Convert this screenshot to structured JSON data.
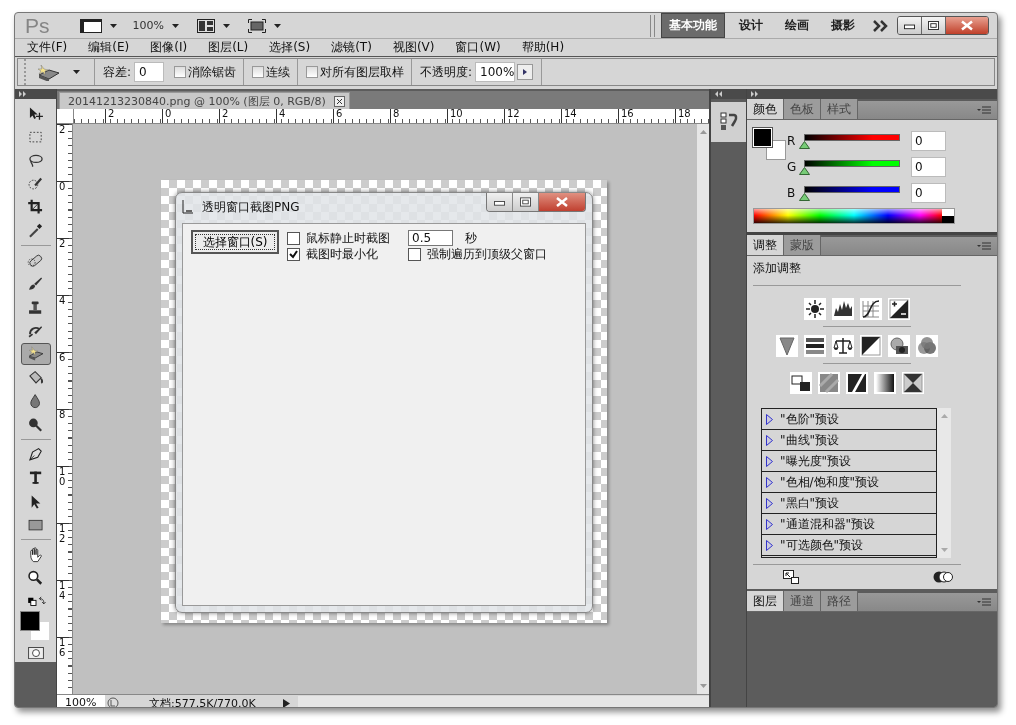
{
  "app": {
    "logo": "Ps",
    "zoom": "100%"
  },
  "workspaces": [
    {
      "label": "基本功能",
      "selected": true
    },
    {
      "label": "设计",
      "selected": false
    },
    {
      "label": "绘画",
      "selected": false
    },
    {
      "label": "摄影",
      "selected": false
    }
  ],
  "menu": [
    "文件(F)",
    "编辑(E)",
    "图像(I)",
    "图层(L)",
    "选择(S)",
    "滤镜(T)",
    "视图(V)",
    "窗口(W)",
    "帮助(H)"
  ],
  "options": {
    "tolerance_label": "容差:",
    "tolerance": "0",
    "checkboxes": [
      {
        "label": "消除锯齿",
        "checked": false
      },
      {
        "label": "连续",
        "checked": false
      },
      {
        "label": "对所有图层取样",
        "checked": false
      }
    ],
    "opacity_label": "不透明度:",
    "opacity": "100%"
  },
  "tools": [
    {
      "kind": "move",
      "selected": false
    },
    {
      "kind": "marquee",
      "selected": false
    },
    {
      "kind": "lasso",
      "selected": false
    },
    {
      "kind": "quick-select",
      "selected": false
    },
    {
      "kind": "crop",
      "selected": false
    },
    {
      "kind": "eyedropper",
      "selected": false
    },
    {
      "kind": "sep"
    },
    {
      "kind": "heal",
      "selected": false
    },
    {
      "kind": "brush",
      "selected": false
    },
    {
      "kind": "stamp",
      "selected": false
    },
    {
      "kind": "history-brush",
      "selected": false
    },
    {
      "kind": "eraser",
      "selected": true
    },
    {
      "kind": "bucket",
      "selected": false
    },
    {
      "kind": "blur",
      "selected": false
    },
    {
      "kind": "dodge",
      "selected": false
    },
    {
      "kind": "sep"
    },
    {
      "kind": "pen",
      "selected": false
    },
    {
      "kind": "type",
      "selected": false
    },
    {
      "kind": "path-select",
      "selected": false
    },
    {
      "kind": "shape",
      "selected": false
    },
    {
      "kind": "sep"
    },
    {
      "kind": "hand",
      "selected": false
    },
    {
      "kind": "zoom",
      "selected": false
    }
  ],
  "document": {
    "tab": "20141213230840.png @ 100% (图层 0, RGB/8)",
    "ruler_h": [
      "2",
      "0",
      "2",
      "4",
      "6",
      "8",
      "10",
      "12",
      "14",
      "16",
      "18"
    ],
    "ruler_v": [
      "2",
      "0",
      "2",
      "4",
      "6",
      "8",
      "10",
      "12",
      "14",
      "16"
    ],
    "status_zoom": "100%",
    "status_doc": "文档:577.5K/770.0K"
  },
  "captured_window": {
    "title": "透明窗口截图PNG",
    "button": "选择窗口(S)",
    "checkboxes": [
      {
        "label": "鼠标静止时截图",
        "checked": false
      },
      {
        "label": "截图时最小化",
        "checked": true
      }
    ],
    "interval": "0.5",
    "unit": "秒",
    "force_checkbox": {
      "label": "强制遍历到顶级父窗口",
      "checked": false
    }
  },
  "color_panel": {
    "tabs": [
      {
        "label": "颜色",
        "selected": true
      },
      {
        "label": "色板",
        "selected": false
      },
      {
        "label": "样式",
        "selected": false
      }
    ],
    "channels": [
      {
        "name": "R",
        "value": "0",
        "level": 0,
        "color": "#ff0000"
      },
      {
        "name": "G",
        "value": "0",
        "level": 0,
        "color": "#00ff00"
      },
      {
        "name": "B",
        "value": "0",
        "level": 0,
        "color": "#0000ff"
      }
    ]
  },
  "adjust_panel": {
    "tabs": [
      {
        "label": "调整",
        "selected": true
      },
      {
        "label": "蒙版",
        "selected": false
      }
    ],
    "heading": "添加调整",
    "presets": [
      "\"色阶\"预设",
      "\"曲线\"预设",
      "\"曝光度\"预设",
      "\"色相/饱和度\"预设",
      "\"黑白\"预设",
      "\"通道混和器\"预设",
      "\"可选颜色\"预设"
    ]
  },
  "layers_panel": {
    "tabs": [
      {
        "label": "图层",
        "selected": true
      },
      {
        "label": "通道",
        "selected": false
      },
      {
        "label": "路径",
        "selected": false
      }
    ]
  }
}
